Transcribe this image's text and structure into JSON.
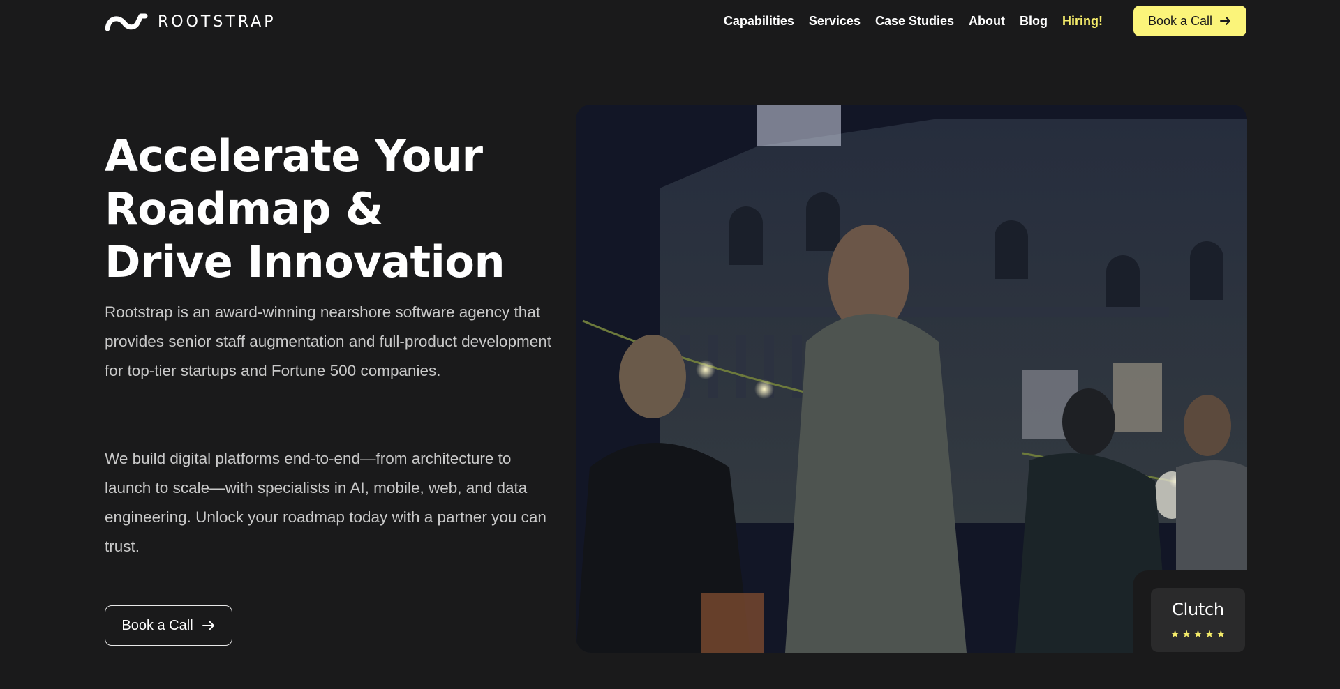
{
  "header": {
    "logo_text": "ROOTSTRAP",
    "nav": [
      {
        "label": "Capabilities"
      },
      {
        "label": "Services"
      },
      {
        "label": "Case Studies"
      },
      {
        "label": "About"
      },
      {
        "label": "Blog"
      },
      {
        "label": "Hiring!",
        "highlight": true
      }
    ],
    "cta_label": "Book a Call"
  },
  "hero": {
    "title_lines": [
      "Accelerate Your",
      "Roadmap &",
      "Drive Innovation"
    ],
    "paragraph1": "Rootstrap is an award-winning nearshore software agency that provides senior staff augmentation and full-product development for top-tier startups and Fortune 500 companies.",
    "paragraph2": "We build digital platforms end-to-end—from architecture to launch to scale—with specialists in AI, mobile, web, and data engineering. Unlock your roadmap today with a partner you can trust.",
    "cta_label": "Book a Call"
  },
  "clutch": {
    "name": "Clutch",
    "rating": 5,
    "star_glyph": "★"
  },
  "colors": {
    "background": "#1a1a1b",
    "accent": "#fbf47a",
    "hiring": "#f5ec6a",
    "text_muted": "#c9c9c9"
  },
  "icons": {
    "arrow": "arrow-right-icon",
    "star": "star-icon",
    "logo_mark": "rootstrap-wave-icon"
  }
}
